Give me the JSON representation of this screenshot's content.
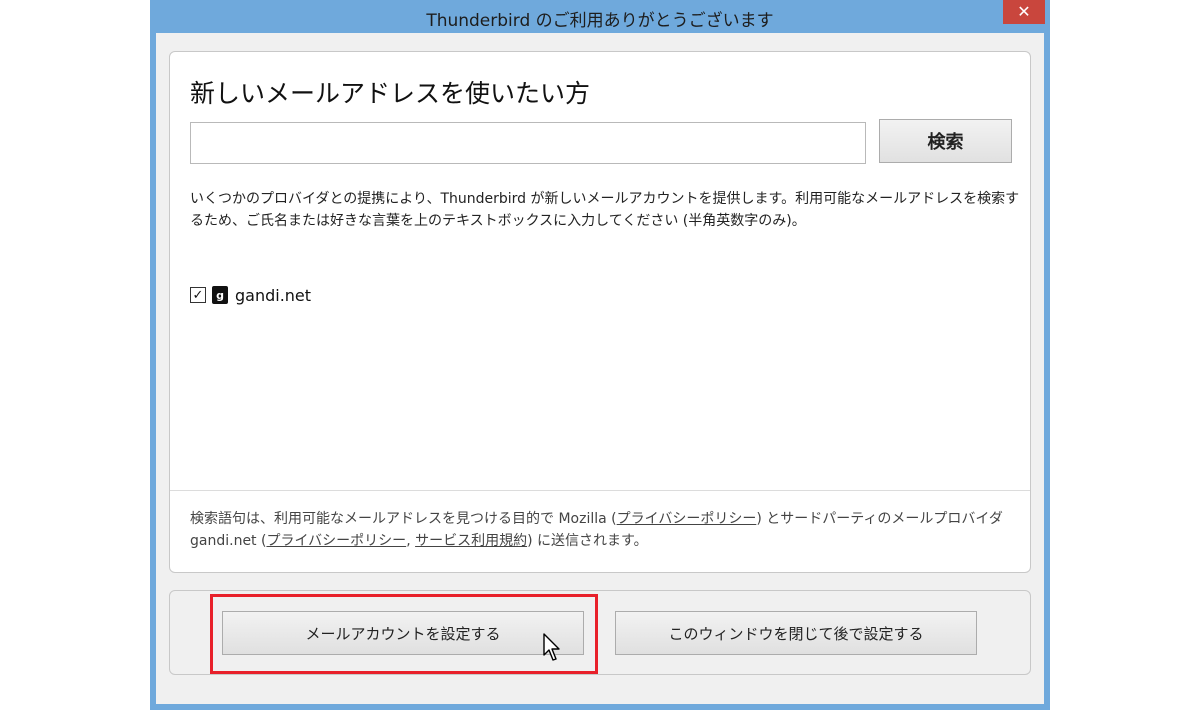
{
  "window": {
    "title": "Thunderbird のご利用ありがとうございます",
    "close_label": "✕"
  },
  "main": {
    "heading": "新しいメールアドレスを使いたい方",
    "search_value": "",
    "search_button": "検索",
    "description": "いくつかのプロバイダとの提携により、Thunderbird が新しいメールアカウントを提供します。利用可能なメールアドレスを検索するため、ご氏名または好きな言葉を上のテキストボックスに入力してください (半角英数字のみ)。",
    "provider": {
      "checked": true,
      "check_mark": "✓",
      "icon_glyph": "g",
      "label": "gandi.net"
    },
    "privacy": {
      "part1": "検索語句は、利用可能なメールアドレスを見つける目的で Mozilla (",
      "link_mozilla_privacy": "プライバシーポリシー",
      "part2": ") とサードパーティのメールプロバイダ gandi.net (",
      "link_gandi_privacy": "プライバシーポリシー",
      "separator": ", ",
      "link_gandi_terms": "サービス利用規約",
      "part3": ") に送信されます。"
    }
  },
  "footer": {
    "setup_account_button": "メールアカウントを設定する",
    "close_later_button": "このウィンドウを閉じて後で設定する"
  },
  "colors": {
    "titlebar": "#6fa9dc",
    "close_button": "#c9463d",
    "highlight": "#e8202a"
  }
}
